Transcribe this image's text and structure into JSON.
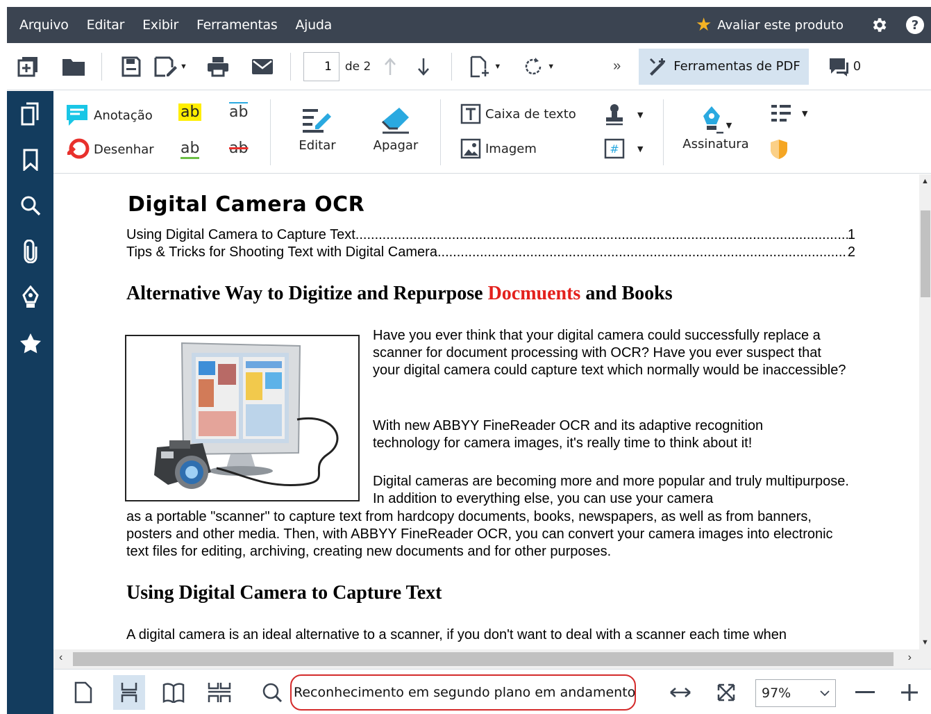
{
  "menu": {
    "items": [
      "Arquivo",
      "Editar",
      "Exibir",
      "Ferramentas",
      "Ajuda"
    ],
    "rate_label": "Avaliar este produto"
  },
  "toolbar": {
    "page_current": "1",
    "page_of": "de 2",
    "pdf_tools_label": "Ferramentas de PDF",
    "comments_count": "0",
    "more": "»"
  },
  "ribbon": {
    "annotation": "Anotação",
    "draw": "Desenhar",
    "edit": "Editar",
    "erase": "Apagar",
    "text_box": "Caixa de texto",
    "image": "Imagem",
    "signature": "Assinatura",
    "highlight_ab": "ab"
  },
  "document": {
    "title": "Digital Camera OCR",
    "toc": [
      {
        "text": "Using Digital Camera to Capture Text",
        "page": "1"
      },
      {
        "text": "Tips & Tricks for Shooting Text with Digital Camera",
        "page": "2"
      }
    ],
    "heading1_pre": "Alternative Way to Digitize and Repurpose ",
    "heading1_red": "Docmuents",
    "heading1_post": " and Books",
    "para1": "Have you ever think that your digital camera could successfully replace a scanner for document processing with OCR? Have you ever suspect that your digital camera could capture text which normally would be inaccessible?",
    "para2": "With new ABBYY FineReader OCR and its adaptive recognition technology  for camera images, it's really time to think about it!",
    "para3_top": "Digital cameras are becoming more and more popular and truly multipurpose. In addition to everything else, you can use your camera",
    "para3_rest": "as a portable \"scanner\" to capture text from hardcopy documents, books, newspapers, as well as from banners, posters and other media. Then, with ABBYY FineReader OCR, you can convert your camera images into electronic text files for editing, archiving, creating new documents and for other purposes.",
    "heading2": "Using Digital Camera to Capture Text",
    "para4": "A digital camera is an ideal alternative to a scanner, if you don't want to deal with a scanner each time when"
  },
  "statusbar": {
    "background_status": "Reconhecimento em segundo plano em andamento...",
    "zoom": "97%"
  },
  "colors": {
    "menubar_bg": "#3b4451",
    "sidebar_bg": "#133c5e",
    "accent_red": "#e3211d",
    "status_highlight": "#d42b2b",
    "pdf_tools_bg": "#d5e3f0"
  }
}
